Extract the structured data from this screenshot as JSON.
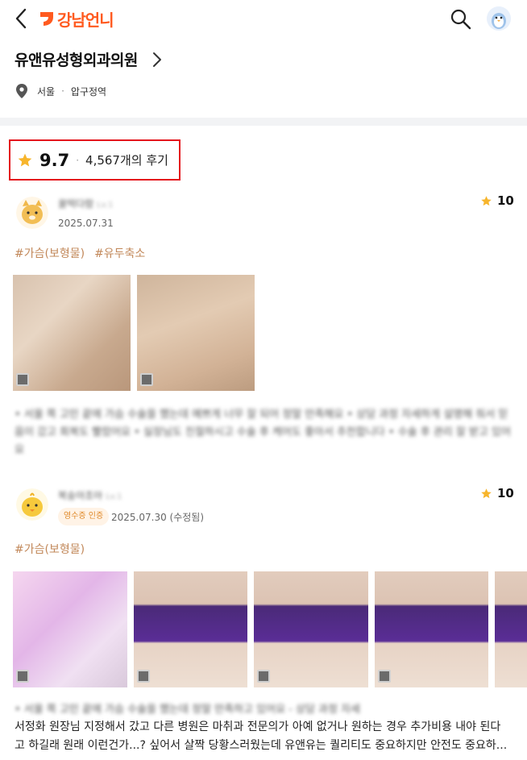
{
  "header": {
    "logo_text": "강남언니",
    "brand_color": "#ff5a1f"
  },
  "hospital": {
    "name": "유앤유성형외과의원",
    "city": "서울",
    "area": "압구정역"
  },
  "rating": {
    "score": "9.7",
    "separator": "·",
    "review_count": "4,567개의 후기",
    "star_color": "#f7b52c"
  },
  "reviews": [
    {
      "nickname": "꿀떡다람",
      "level": "Lv.1",
      "date": "2025.07.31",
      "score": "10",
      "tags": [
        "#가슴(보형물)",
        "#유두축소"
      ],
      "photo_count": 2,
      "text_blurred": "• 서울 쪽 고민 끝에 가슴 수술을 했는데 예쁘게 너무 잘 되어 정말 만족해요 • 상담 과정 자세하게 설명해 줘서 믿음이 갔고 회복도 빨랐어요 • 실장님도 친절하시고 수술 후 케어도 좋아서 추천합니다 • 수술 후 관리 잘 받고 있어요"
    },
    {
      "nickname": "복숭아조아",
      "level": "Lv.1",
      "badge": "영수증 인증",
      "date": "2025.07.30 (수정됨)",
      "score": "10",
      "tags": [
        "#가슴(보형물)"
      ],
      "photo_count": 5,
      "text_blurred": "• 서울 쪽 고민 끝에 가슴 수술을 했는데 정말 만족하고 있어요 - 상담 과정 자세",
      "text_line1": "서정화 원장님 지정해서 갔고 다른 병원은 마취과 전문의가 아예 없거나 원하는 경우 추가비용 내야 된다",
      "text_line2": "고 하길래 원래 이런건가...? 싶어서 살짝 당황스러웠는데 유앤유는 퀄리티도 중요하지만 안전도 중요하..."
    }
  ]
}
